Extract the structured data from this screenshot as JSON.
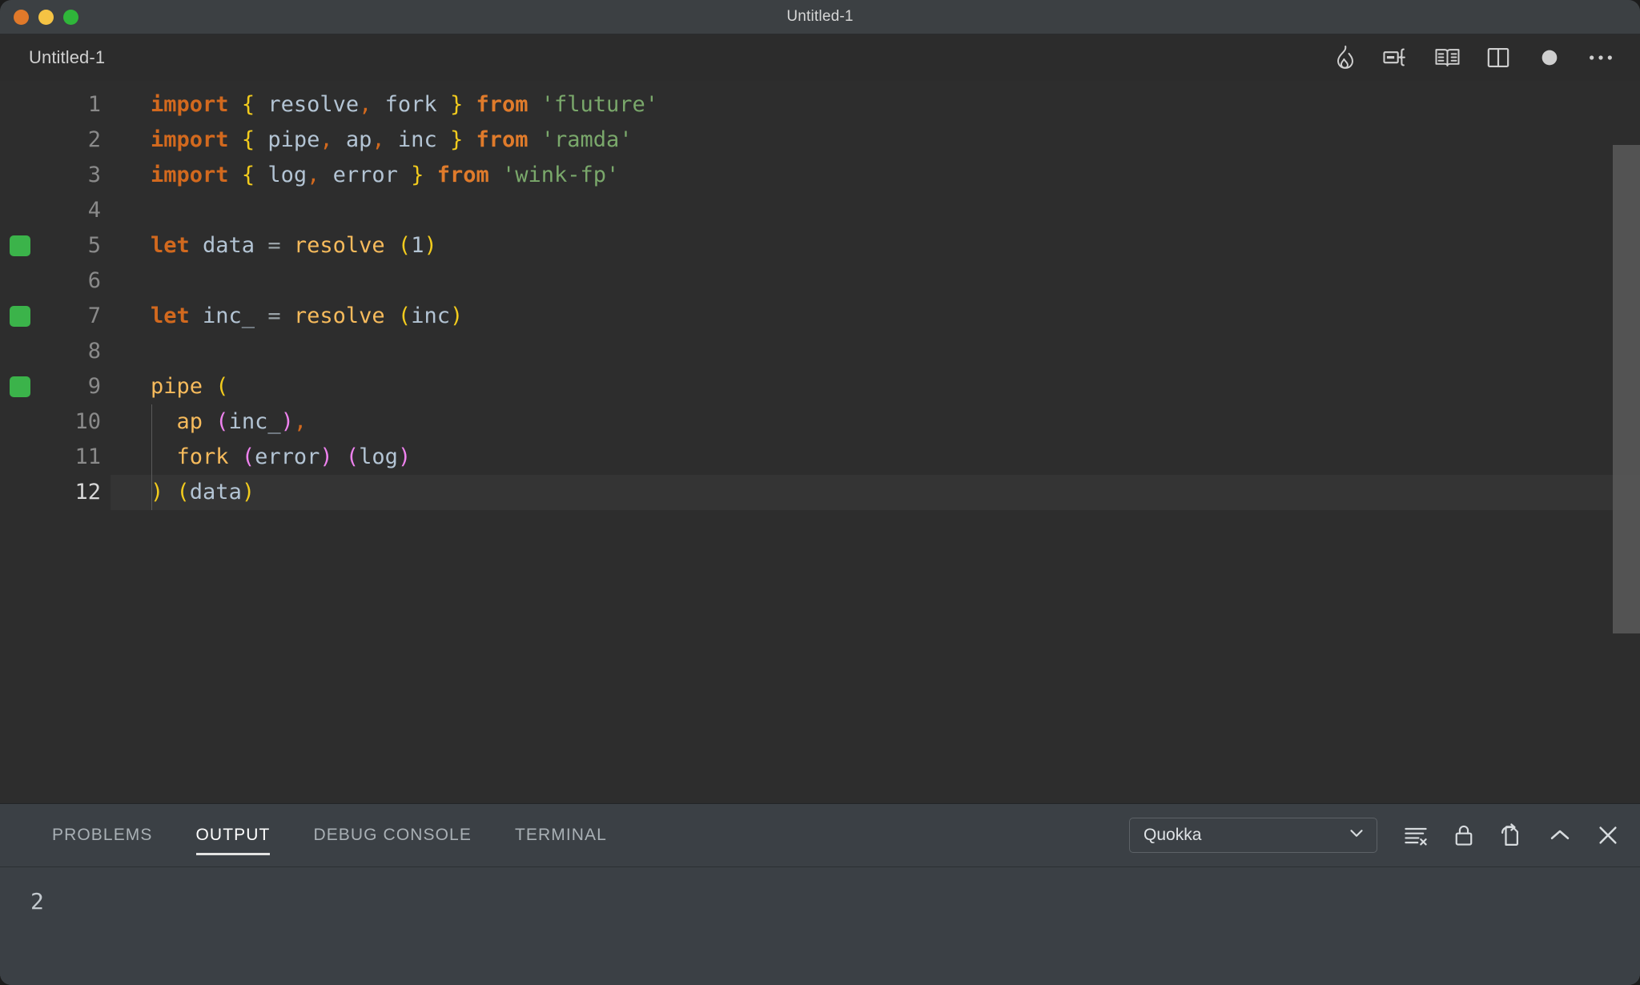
{
  "window": {
    "title": "Untitled-1",
    "traffic_lights": [
      "close",
      "minimize",
      "maximize"
    ],
    "colors": {
      "titlebar_bg": "#3c4043",
      "editor_bg": "#2d2d2d",
      "panel_bg": "#3b4045",
      "quokka_green": "#3bb34a",
      "accent_orange": "#d2691e",
      "string_green": "#7aa86b",
      "bracket_yellow": "#f2cb1d",
      "bracket_pink": "#ee82ee",
      "function_amber": "#f7bb5c"
    }
  },
  "editor": {
    "tab_label": "Untitled-1",
    "actions": [
      {
        "name": "quokka-flame-icon",
        "label": "Quokka"
      },
      {
        "name": "run-code-icon",
        "label": "Run Code"
      },
      {
        "name": "open-preview-icon",
        "label": "Open Preview"
      },
      {
        "name": "split-editor-icon",
        "label": "Split Editor"
      },
      {
        "name": "record-dot-icon",
        "label": "Record"
      },
      {
        "name": "more-actions-icon",
        "label": "More Actions..."
      }
    ],
    "current_line": 12,
    "lines": [
      {
        "no": "1",
        "deco": false,
        "tokens": [
          {
            "c": "t-kw",
            "t": "import"
          },
          {
            "c": "t-var",
            "t": " "
          },
          {
            "c": "t-brace",
            "t": "{"
          },
          {
            "c": "t-var",
            "t": " resolve"
          },
          {
            "c": "t-punc",
            "t": ","
          },
          {
            "c": "t-var",
            "t": " fork "
          },
          {
            "c": "t-brace",
            "t": "}"
          },
          {
            "c": "t-var",
            "t": " "
          },
          {
            "c": "t-kw2",
            "t": "from"
          },
          {
            "c": "t-var",
            "t": " "
          },
          {
            "c": "t-str",
            "t": "'fluture'"
          }
        ]
      },
      {
        "no": "2",
        "deco": false,
        "tokens": [
          {
            "c": "t-kw",
            "t": "import"
          },
          {
            "c": "t-var",
            "t": " "
          },
          {
            "c": "t-brace",
            "t": "{"
          },
          {
            "c": "t-var",
            "t": " pipe"
          },
          {
            "c": "t-punc",
            "t": ","
          },
          {
            "c": "t-var",
            "t": " ap"
          },
          {
            "c": "t-punc",
            "t": ","
          },
          {
            "c": "t-var",
            "t": " inc "
          },
          {
            "c": "t-brace",
            "t": "}"
          },
          {
            "c": "t-var",
            "t": " "
          },
          {
            "c": "t-kw2",
            "t": "from"
          },
          {
            "c": "t-var",
            "t": " "
          },
          {
            "c": "t-str",
            "t": "'ramda'"
          }
        ]
      },
      {
        "no": "3",
        "deco": false,
        "tokens": [
          {
            "c": "t-kw",
            "t": "import"
          },
          {
            "c": "t-var",
            "t": " "
          },
          {
            "c": "t-brace",
            "t": "{"
          },
          {
            "c": "t-var",
            "t": " log"
          },
          {
            "c": "t-punc",
            "t": ","
          },
          {
            "c": "t-var",
            "t": " error "
          },
          {
            "c": "t-brace",
            "t": "}"
          },
          {
            "c": "t-var",
            "t": " "
          },
          {
            "c": "t-kw2",
            "t": "from"
          },
          {
            "c": "t-var",
            "t": " "
          },
          {
            "c": "t-str",
            "t": "'wink-fp'"
          }
        ]
      },
      {
        "no": "4",
        "deco": false,
        "tokens": []
      },
      {
        "no": "5",
        "deco": true,
        "tokens": [
          {
            "c": "t-kw",
            "t": "let"
          },
          {
            "c": "t-var",
            "t": " data "
          },
          {
            "c": "t-op",
            "t": "="
          },
          {
            "c": "t-var",
            "t": " "
          },
          {
            "c": "t-fn",
            "t": "resolve"
          },
          {
            "c": "t-var",
            "t": " "
          },
          {
            "c": "t-paren1",
            "t": "("
          },
          {
            "c": "t-num",
            "t": "1"
          },
          {
            "c": "t-paren1",
            "t": ")"
          }
        ]
      },
      {
        "no": "6",
        "deco": false,
        "tokens": []
      },
      {
        "no": "7",
        "deco": true,
        "tokens": [
          {
            "c": "t-kw",
            "t": "let"
          },
          {
            "c": "t-var",
            "t": " inc_ "
          },
          {
            "c": "t-op",
            "t": "="
          },
          {
            "c": "t-var",
            "t": " "
          },
          {
            "c": "t-fn",
            "t": "resolve"
          },
          {
            "c": "t-var",
            "t": " "
          },
          {
            "c": "t-paren1",
            "t": "("
          },
          {
            "c": "t-var",
            "t": "inc"
          },
          {
            "c": "t-paren1",
            "t": ")"
          }
        ]
      },
      {
        "no": "8",
        "deco": false,
        "tokens": []
      },
      {
        "no": "9",
        "deco": true,
        "tokens": [
          {
            "c": "t-fn",
            "t": "pipe"
          },
          {
            "c": "t-var",
            "t": " "
          },
          {
            "c": "t-paren1",
            "t": "("
          }
        ]
      },
      {
        "no": "10",
        "deco": false,
        "tokens": [
          {
            "c": "t-var",
            "t": "  "
          },
          {
            "c": "t-fn",
            "t": "ap"
          },
          {
            "c": "t-var",
            "t": " "
          },
          {
            "c": "t-paren2",
            "t": "("
          },
          {
            "c": "t-var",
            "t": "inc_"
          },
          {
            "c": "t-paren2",
            "t": ")"
          },
          {
            "c": "t-punc",
            "t": ","
          }
        ]
      },
      {
        "no": "11",
        "deco": false,
        "tokens": [
          {
            "c": "t-var",
            "t": "  "
          },
          {
            "c": "t-fn",
            "t": "fork"
          },
          {
            "c": "t-var",
            "t": " "
          },
          {
            "c": "t-paren2",
            "t": "("
          },
          {
            "c": "t-var",
            "t": "error"
          },
          {
            "c": "t-paren2",
            "t": ")"
          },
          {
            "c": "t-var",
            "t": " "
          },
          {
            "c": "t-paren2",
            "t": "("
          },
          {
            "c": "t-var",
            "t": "log"
          },
          {
            "c": "t-paren2",
            "t": ")"
          }
        ]
      },
      {
        "no": "12",
        "deco": false,
        "tokens": [
          {
            "c": "t-paren1",
            "t": ")"
          },
          {
            "c": "t-var",
            "t": " "
          },
          {
            "c": "t-paren1",
            "t": "("
          },
          {
            "c": "t-var",
            "t": "data"
          },
          {
            "c": "t-paren1",
            "t": ")"
          }
        ]
      }
    ]
  },
  "panel": {
    "tabs": [
      {
        "label": "PROBLEMS",
        "active": false
      },
      {
        "label": "OUTPUT",
        "active": true
      },
      {
        "label": "DEBUG CONSOLE",
        "active": false
      },
      {
        "label": "TERMINAL",
        "active": false
      }
    ],
    "channel_select": {
      "value": "Quokka",
      "options": [
        "Quokka"
      ]
    },
    "icons": [
      {
        "name": "clear-output-icon",
        "label": "Clear Output"
      },
      {
        "name": "lock-scroll-icon",
        "label": "Turn Auto Scrolling Off"
      },
      {
        "name": "open-in-editor-icon",
        "label": "Open Output in Editor"
      },
      {
        "name": "maximize-panel-icon",
        "label": "Maximize Panel Size"
      },
      {
        "name": "close-panel-icon",
        "label": "Close Panel"
      }
    ],
    "output_lines": [
      "2"
    ]
  }
}
